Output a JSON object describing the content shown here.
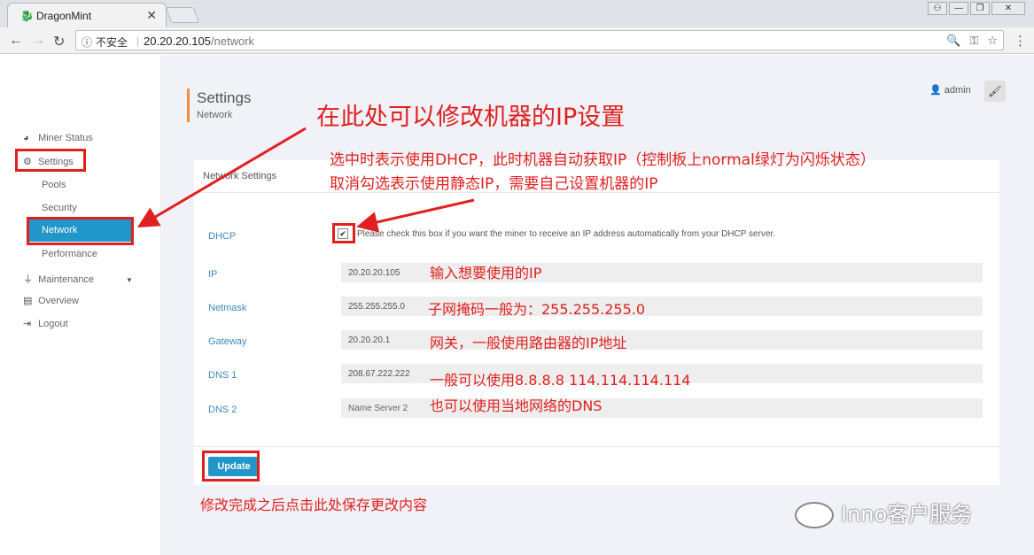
{
  "browser": {
    "tab_title": "DragonMint",
    "tab_close": "✕",
    "insecure_label": "不安全",
    "host": "20.20.20.105",
    "path": "/network",
    "win_buttons": [
      "⚇",
      "—",
      "❐",
      "✕"
    ]
  },
  "sidebar": {
    "items": [
      {
        "label": "Miner Status",
        "icon": "gauge-icon"
      },
      {
        "label": "Settings",
        "icon": "cogs-icon"
      },
      {
        "label": "Pools"
      },
      {
        "label": "Security"
      },
      {
        "label": "Network"
      },
      {
        "label": "Performance"
      },
      {
        "label": "Maintenance",
        "icon": "plug-icon"
      },
      {
        "label": "Overview",
        "icon": "database-icon"
      },
      {
        "label": "Logout",
        "icon": "sign-out-icon"
      }
    ]
  },
  "header": {
    "title": "Settings",
    "subtitle": "Network",
    "user": "admin"
  },
  "panel": {
    "title": "Network Settings",
    "dhcp_label": "DHCP",
    "dhcp_checked": true,
    "dhcp_help": "Please check this box if you want the miner to receive an IP address automatically from your DHCP server.",
    "fields": [
      {
        "label": "IP",
        "value": "20.20.20.105",
        "placeholder": ""
      },
      {
        "label": "Netmask",
        "value": "255.255.255.0",
        "placeholder": ""
      },
      {
        "label": "Gateway",
        "value": "20.20.20.1",
        "placeholder": ""
      },
      {
        "label": "DNS 1",
        "value": "208.67.222.222",
        "placeholder": ""
      },
      {
        "label": "DNS 2",
        "value": "",
        "placeholder": "Name Server 2"
      }
    ],
    "update_label": "Update"
  },
  "annotations": {
    "title": "在此处可以修改机器的IP设置",
    "dhcp_line1": "选中时表示使用DHCP，此时机器自动获取IP（控制板上normal绿灯为闪烁状态）",
    "dhcp_line2": "取消勾选表示使用静态IP，需要自己设置机器的IP",
    "ip": "输入想要使用的IP",
    "netmask": "子网掩码一般为：255.255.255.0",
    "gateway": "网关，一般使用路由器的IP地址",
    "dns1": "一般可以使用8.8.8.8     114.114.114.114",
    "dns2": "也可以使用当地网络的DNS",
    "update": "修改完成之后点击此处保存更改内容",
    "color": "#e02020"
  },
  "watermark": "Inno客户服务"
}
